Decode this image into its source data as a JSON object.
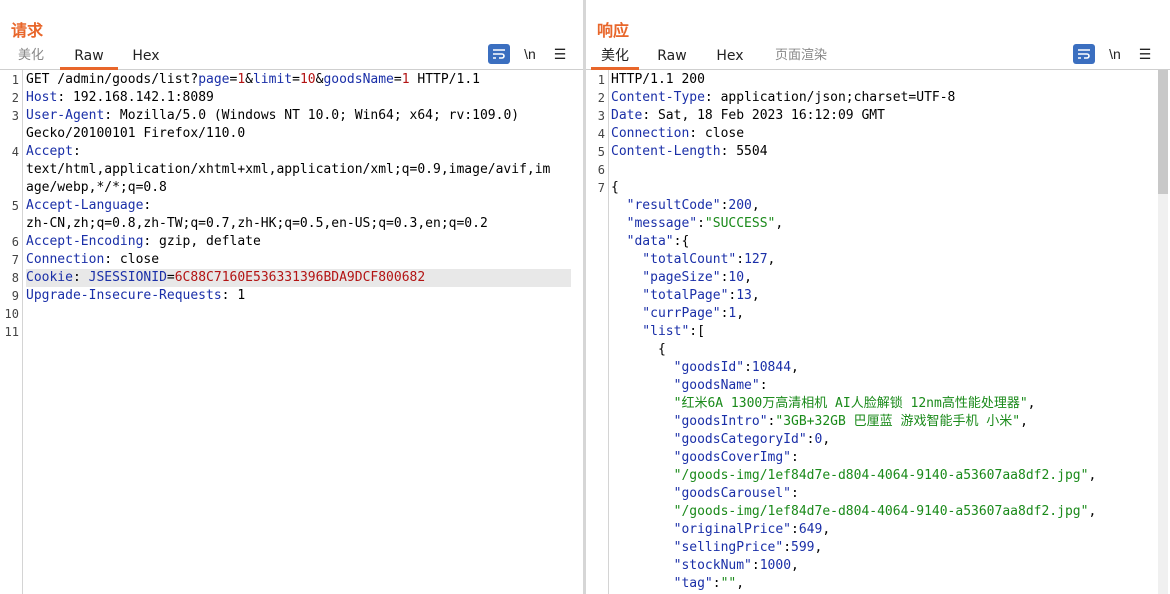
{
  "layout_toggle": {
    "options": [
      "side-by-side",
      "horizontal",
      "tabs"
    ],
    "active": 0
  },
  "request": {
    "title": "请求",
    "tabs": [
      {
        "label": "美化",
        "active": false
      },
      {
        "label": "Raw",
        "active": true
      },
      {
        "label": "Hex",
        "active": false
      }
    ],
    "tools": {
      "wrap": "wrap-lines-icon",
      "newline": "\\n",
      "menu": "☰"
    },
    "line_numbers": [
      "1",
      "2",
      "3",
      "",
      "4",
      "",
      "",
      "5",
      "",
      "6",
      "7",
      "8",
      "9",
      "10",
      "11"
    ],
    "lines": [
      {
        "parts": [
          {
            "t": "GET /admin/goods/list?",
            "c": ""
          },
          {
            "t": "page",
            "c": "pn"
          },
          {
            "t": "=",
            "c": ""
          },
          {
            "t": "1",
            "c": "pv"
          },
          {
            "t": "&",
            "c": ""
          },
          {
            "t": "limit",
            "c": "pn"
          },
          {
            "t": "=",
            "c": ""
          },
          {
            "t": "10",
            "c": "pv"
          },
          {
            "t": "&",
            "c": ""
          },
          {
            "t": "goodsName",
            "c": "pn"
          },
          {
            "t": "=",
            "c": ""
          },
          {
            "t": "1",
            "c": "pv"
          },
          {
            "t": " HTTP/1.1",
            "c": ""
          }
        ]
      },
      {
        "parts": [
          {
            "t": "Host",
            "c": "hk"
          },
          {
            "t": ": 192.168.142.1:8089",
            "c": ""
          }
        ]
      },
      {
        "parts": [
          {
            "t": "User-Agent",
            "c": "hk"
          },
          {
            "t": ": Mozilla/5.0 (Windows NT 10.0; Win64; x64; rv:109.0)",
            "c": ""
          }
        ]
      },
      {
        "parts": [
          {
            "t": "Gecko/20100101 Firefox/110.0",
            "c": ""
          }
        ]
      },
      {
        "parts": [
          {
            "t": "Accept",
            "c": "hk"
          },
          {
            "t": ":",
            "c": ""
          }
        ]
      },
      {
        "parts": [
          {
            "t": "text/html,application/xhtml+xml,application/xml;q=0.9,image/avif,im",
            "c": ""
          }
        ]
      },
      {
        "parts": [
          {
            "t": "age/webp,*/*;q=0.8",
            "c": ""
          }
        ]
      },
      {
        "parts": [
          {
            "t": "Accept-Language",
            "c": "hk"
          },
          {
            "t": ":",
            "c": ""
          }
        ]
      },
      {
        "parts": [
          {
            "t": "zh-CN,zh;q=0.8,zh-TW;q=0.7,zh-HK;q=0.5,en-US;q=0.3,en;q=0.2",
            "c": ""
          }
        ]
      },
      {
        "parts": [
          {
            "t": "Accept-Encoding",
            "c": "hk"
          },
          {
            "t": ": gzip, deflate",
            "c": ""
          }
        ]
      },
      {
        "parts": [
          {
            "t": "Connection",
            "c": "hk"
          },
          {
            "t": ": close",
            "c": ""
          }
        ]
      },
      {
        "hl": true,
        "parts": [
          {
            "t": "Cookie",
            "c": "hk"
          },
          {
            "t": ": ",
            "c": ""
          },
          {
            "t": "JSESSIONID",
            "c": "pn"
          },
          {
            "t": "=",
            "c": ""
          },
          {
            "t": "6C88C7160E536331396BDA9DCF800682",
            "c": "pv"
          }
        ]
      },
      {
        "parts": [
          {
            "t": "Upgrade-Insecure-Requests",
            "c": "hk"
          },
          {
            "t": ": 1",
            "c": ""
          }
        ]
      },
      {
        "parts": []
      },
      {
        "parts": []
      }
    ]
  },
  "response": {
    "title": "响应",
    "tabs": [
      {
        "label": "美化",
        "active": true
      },
      {
        "label": "Raw",
        "active": false
      },
      {
        "label": "Hex",
        "active": false
      },
      {
        "label": "页面渲染",
        "active": false,
        "muted": true
      }
    ],
    "tools": {
      "wrap": "wrap-lines-icon",
      "newline": "\\n",
      "menu": "☰"
    },
    "line_numbers": [
      "1",
      "2",
      "3",
      "4",
      "5",
      "6",
      "7",
      "",
      "",
      "",
      "",
      "",
      "",
      "",
      "",
      "",
      "",
      "",
      "",
      "",
      "",
      "",
      "",
      "",
      ""
    ],
    "lines": [
      {
        "parts": [
          {
            "t": "HTTP/1.1 200",
            "c": ""
          }
        ]
      },
      {
        "parts": [
          {
            "t": "Content-Type",
            "c": "hk"
          },
          {
            "t": ": application/json;charset=UTF-8",
            "c": ""
          }
        ]
      },
      {
        "parts": [
          {
            "t": "Date",
            "c": "hk"
          },
          {
            "t": ": Sat, 18 Feb 2023 16:12:09 GMT",
            "c": ""
          }
        ]
      },
      {
        "parts": [
          {
            "t": "Connection",
            "c": "hk"
          },
          {
            "t": ": close",
            "c": ""
          }
        ]
      },
      {
        "parts": [
          {
            "t": "Content-Length",
            "c": "hk"
          },
          {
            "t": ": 5504",
            "c": ""
          }
        ]
      },
      {
        "parts": []
      },
      {
        "parts": [
          {
            "t": "{",
            "c": ""
          }
        ]
      },
      {
        "parts": [
          {
            "t": "  \"resultCode\"",
            "c": "jk"
          },
          {
            "t": ":",
            "c": ""
          },
          {
            "t": "200",
            "c": "jn"
          },
          {
            "t": ",",
            "c": ""
          }
        ]
      },
      {
        "parts": [
          {
            "t": "  \"message\"",
            "c": "jk"
          },
          {
            "t": ":",
            "c": ""
          },
          {
            "t": "\"SUCCESS\"",
            "c": "js"
          },
          {
            "t": ",",
            "c": ""
          }
        ]
      },
      {
        "parts": [
          {
            "t": "  \"data\"",
            "c": "jk"
          },
          {
            "t": ":{",
            "c": ""
          }
        ]
      },
      {
        "parts": [
          {
            "t": "    \"totalCount\"",
            "c": "jk"
          },
          {
            "t": ":",
            "c": ""
          },
          {
            "t": "127",
            "c": "jn"
          },
          {
            "t": ",",
            "c": ""
          }
        ]
      },
      {
        "parts": [
          {
            "t": "    \"pageSize\"",
            "c": "jk"
          },
          {
            "t": ":",
            "c": ""
          },
          {
            "t": "10",
            "c": "jn"
          },
          {
            "t": ",",
            "c": ""
          }
        ]
      },
      {
        "parts": [
          {
            "t": "    \"totalPage\"",
            "c": "jk"
          },
          {
            "t": ":",
            "c": ""
          },
          {
            "t": "13",
            "c": "jn"
          },
          {
            "t": ",",
            "c": ""
          }
        ]
      },
      {
        "parts": [
          {
            "t": "    \"currPage\"",
            "c": "jk"
          },
          {
            "t": ":",
            "c": ""
          },
          {
            "t": "1",
            "c": "jn"
          },
          {
            "t": ",",
            "c": ""
          }
        ]
      },
      {
        "parts": [
          {
            "t": "    \"list\"",
            "c": "jk"
          },
          {
            "t": ":[",
            "c": ""
          }
        ]
      },
      {
        "parts": [
          {
            "t": "      {",
            "c": ""
          }
        ]
      },
      {
        "parts": [
          {
            "t": "        \"goodsId\"",
            "c": "jk"
          },
          {
            "t": ":",
            "c": ""
          },
          {
            "t": "10844",
            "c": "jn"
          },
          {
            "t": ",",
            "c": ""
          }
        ]
      },
      {
        "parts": [
          {
            "t": "        \"goodsName\"",
            "c": "jk"
          },
          {
            "t": ":",
            "c": ""
          }
        ]
      },
      {
        "parts": [
          {
            "t": "        \"红米6A 1300万高清相机 AI人脸解锁 12nm高性能处理器\"",
            "c": "js"
          },
          {
            "t": ",",
            "c": ""
          }
        ]
      },
      {
        "parts": [
          {
            "t": "        \"goodsIntro\"",
            "c": "jk"
          },
          {
            "t": ":",
            "c": ""
          },
          {
            "t": "\"3GB+32GB 巴厘蓝 游戏智能手机 小米\"",
            "c": "js"
          },
          {
            "t": ",",
            "c": ""
          }
        ]
      },
      {
        "parts": [
          {
            "t": "        \"goodsCategoryId\"",
            "c": "jk"
          },
          {
            "t": ":",
            "c": ""
          },
          {
            "t": "0",
            "c": "jn"
          },
          {
            "t": ",",
            "c": ""
          }
        ]
      },
      {
        "parts": [
          {
            "t": "        \"goodsCoverImg\"",
            "c": "jk"
          },
          {
            "t": ":",
            "c": ""
          }
        ]
      },
      {
        "parts": [
          {
            "t": "        \"/goods-img/1ef84d7e-d804-4064-9140-a53607aa8df2.jpg\"",
            "c": "js"
          },
          {
            "t": ",",
            "c": ""
          }
        ]
      },
      {
        "parts": [
          {
            "t": "        \"goodsCarousel\"",
            "c": "jk"
          },
          {
            "t": ":",
            "c": ""
          }
        ]
      },
      {
        "parts": [
          {
            "t": "        \"/goods-img/1ef84d7e-d804-4064-9140-a53607aa8df2.jpg\"",
            "c": "js"
          },
          {
            "t": ",",
            "c": ""
          }
        ]
      },
      {
        "parts": [
          {
            "t": "        \"originalPrice\"",
            "c": "jk"
          },
          {
            "t": ":",
            "c": ""
          },
          {
            "t": "649",
            "c": "jn"
          },
          {
            "t": ",",
            "c": ""
          }
        ]
      },
      {
        "parts": [
          {
            "t": "        \"sellingPrice\"",
            "c": "jk"
          },
          {
            "t": ":",
            "c": ""
          },
          {
            "t": "599",
            "c": "jn"
          },
          {
            "t": ",",
            "c": ""
          }
        ]
      },
      {
        "parts": [
          {
            "t": "        \"stockNum\"",
            "c": "jk"
          },
          {
            "t": ":",
            "c": ""
          },
          {
            "t": "1000",
            "c": "jn"
          },
          {
            "t": ",",
            "c": ""
          }
        ]
      },
      {
        "parts": [
          {
            "t": "        \"tag\"",
            "c": "jk"
          },
          {
            "t": ":",
            "c": ""
          },
          {
            "t": "\"\"",
            "c": "js"
          },
          {
            "t": ",",
            "c": ""
          }
        ]
      }
    ]
  }
}
